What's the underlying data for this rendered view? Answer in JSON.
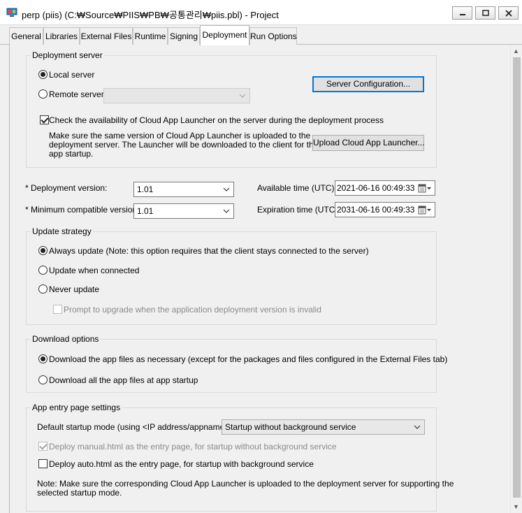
{
  "window": {
    "title": "perp (piis) (C:₩Source₩PIIS₩PB₩공통관리₩piis.pbl) - Project"
  },
  "tabs": [
    "General",
    "Libraries",
    "External Files",
    "Runtime",
    "Signing",
    "Deployment",
    "Run Options"
  ],
  "active_tab": "Deployment",
  "deployment_server": {
    "legend": "Deployment server",
    "local_label": "Local server",
    "remote_label": "Remote server",
    "remote_value": "",
    "config_button": "Server Configuration...",
    "check_label": "Check the availability of Cloud App Launcher on the server during the deployment process",
    "note_line1": "Make sure the same version of Cloud App Launcher is uploaded to the",
    "note_line2": "deployment server.  The Launcher will be downloaded to the client for the",
    "note_line3": "app startup.",
    "upload_button": "Upload Cloud App Launcher..."
  },
  "versions": {
    "req_mark": "*",
    "deployment_label": "Deployment version:",
    "deployment_value": "1.01",
    "min_label": "Minimum compatible version:",
    "min_value": "1.01",
    "available_label": "Available time (UTC):",
    "available_value": "2021-06-16 00:49:33",
    "expiration_label": "Expiration time (UTC):",
    "expiration_value": "2031-06-16 00:49:33"
  },
  "update_strategy": {
    "legend": "Update strategy",
    "always": "Always update (Note: this option requires that the client stays connected to the server)",
    "when_connected": "Update when connected",
    "never": "Never update",
    "prompt": "Prompt to upgrade when the application deployment version is invalid"
  },
  "download_options": {
    "legend": "Download options",
    "as_necessary": "Download the app files as necessary (except for the packages and files configured in the External Files tab)",
    "all": "Download all the app files at app startup"
  },
  "entry_page": {
    "legend": "App entry page settings",
    "mode_label": "Default startup mode (using <IP address/appname>):",
    "mode_value": "Startup without background service",
    "manual_label": "Deploy manual.html as the entry page, for startup without background service",
    "auto_label": "Deploy auto.html as the entry page, for startup with background service",
    "note_line1": "Note: Make sure the corresponding Cloud App Launcher is uploaded to the deployment server for supporting the",
    "note_line2": "selected startup mode."
  },
  "icons": [
    "app-icon",
    "minimize-icon",
    "maximize-icon",
    "close-icon",
    "chevron-down-icon",
    "calendar-icon",
    "scroll-up-icon",
    "scroll-down-icon"
  ],
  "colors": {
    "focus": "#0078d7",
    "panel": "#f0f0f0"
  }
}
